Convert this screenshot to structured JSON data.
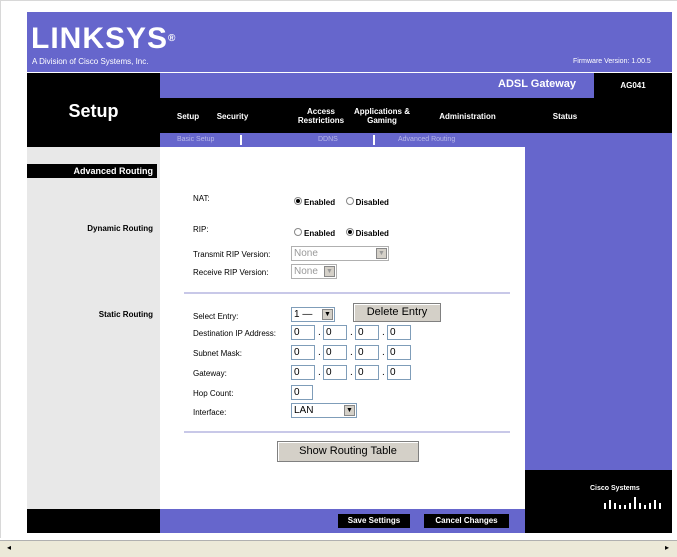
{
  "brand": {
    "logo": "LINKSYS",
    "logo_mark": "®",
    "division": "A Division of Cisco Systems, Inc."
  },
  "firmware": "Firmware Version: 1.00.5",
  "product": {
    "name": "ADSL Gateway",
    "model": "AG041"
  },
  "page_title": "Setup",
  "tabs": [
    {
      "label": "Setup"
    },
    {
      "label": "Security"
    },
    {
      "label": "Access Restrictions"
    },
    {
      "label": "Applications & Gaming"
    },
    {
      "label": "Administration"
    },
    {
      "label": "Status"
    }
  ],
  "subtabs": [
    "Basic Setup",
    "DDNS",
    "Advanced Routing"
  ],
  "sidebar": {
    "section": "Advanced Routing",
    "dynamic": "Dynamic Routing",
    "static": "Static Routing"
  },
  "nat": {
    "label": "NAT:",
    "enabled": "Enabled",
    "disabled": "Disabled",
    "selected": "Enabled"
  },
  "rip": {
    "label": "RIP:",
    "enabled": "Enabled",
    "disabled": "Disabled",
    "selected": "Disabled"
  },
  "transmit_rip": {
    "label": "Transmit RIP Version:",
    "value": "None"
  },
  "receive_rip": {
    "label": "Receive RIP Version:",
    "value": "None"
  },
  "static": {
    "select_entry_label": "Select Entry:",
    "select_entry_value": "1 —",
    "delete_button": "Delete Entry",
    "dest_label": "Destination IP Address:",
    "dest": [
      "0",
      "0",
      "0",
      "0"
    ],
    "mask_label": "Subnet Mask:",
    "mask": [
      "0",
      "0",
      "0",
      "0"
    ],
    "gw_label": "Gateway:",
    "gw": [
      "0",
      "0",
      "0",
      "0"
    ],
    "hop_label": "Hop Count:",
    "hop": "0",
    "iface_label": "Interface:",
    "iface": "LAN",
    "show_table_button": "Show Routing Table"
  },
  "footer": {
    "save": "Save Settings",
    "cancel": "Cancel Changes"
  },
  "cisco_logo": "Cisco Systems",
  "scroll": {
    "left": "◂",
    "right": "▸"
  },
  "colors": {
    "purple": "#6666cc",
    "black": "#000000"
  }
}
